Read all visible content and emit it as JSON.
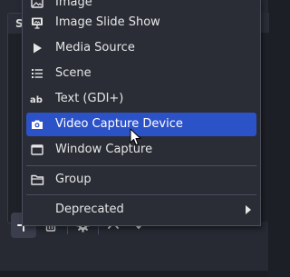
{
  "background": {
    "dock_header_text": "S"
  },
  "menu": {
    "items": [
      {
        "label": "Image",
        "icon": "image-icon"
      },
      {
        "label": "Image Slide Show",
        "icon": "slideshow-icon"
      },
      {
        "label": "Media Source",
        "icon": "play-icon"
      },
      {
        "label": "Scene",
        "icon": "list-icon"
      },
      {
        "label": "Text (GDI+)",
        "icon": "text-ab-icon"
      },
      {
        "label": "Video Capture Device",
        "icon": "camera-icon",
        "selected": true
      },
      {
        "label": "Window Capture",
        "icon": "window-icon"
      },
      {
        "label": "Group",
        "icon": "folder-icon"
      },
      {
        "label": "Deprecated",
        "icon": "none",
        "has_submenu": true
      }
    ]
  },
  "toolbar": {
    "buttons": [
      {
        "icon": "plus-icon",
        "active": true
      },
      {
        "icon": "trash-icon"
      },
      {
        "icon": "gear-icon"
      },
      {
        "icon": "chevron-up-icon"
      },
      {
        "icon": "chevron-down-icon"
      }
    ]
  },
  "colors": {
    "menu_bg": "#2a2d36",
    "selection": "#2c52c8",
    "text": "#e6e6e6"
  }
}
